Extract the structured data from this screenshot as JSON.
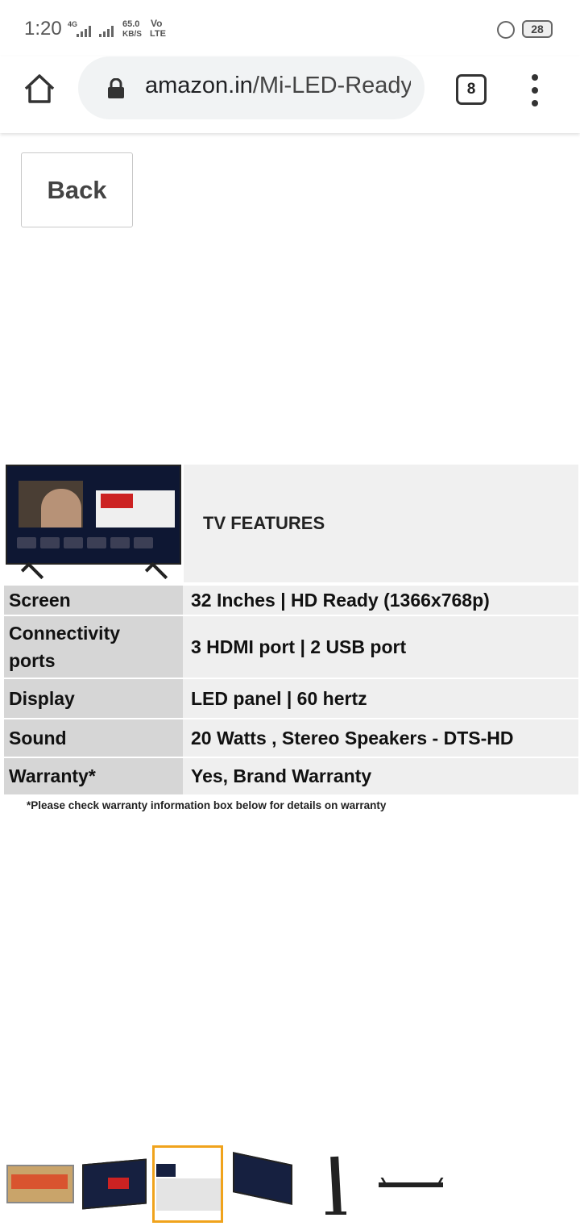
{
  "status_bar": {
    "time": "1:20",
    "net_gen": "4G",
    "speed_value": "65.0",
    "speed_unit": "KB/S",
    "volte_top": "Vo",
    "volte_bottom": "LTE",
    "battery": "28"
  },
  "browser": {
    "url_domain": "amazon.in",
    "url_path": "/Mi-LED-Ready",
    "tab_count": "8"
  },
  "back_button": "Back",
  "product_image": {
    "features_title": "TV FEATURES",
    "specs": [
      {
        "label": "Screen",
        "value": "32 Inches | HD Ready (1366x768p)"
      },
      {
        "label": "Connectivity ports",
        "value": "3 HDMI port | 2 USB port"
      },
      {
        "label": "Display",
        "value": "LED panel | 60 hertz"
      },
      {
        "label": "Sound",
        "value": "20 Watts , Stereo Speakers - DTS-HD"
      },
      {
        "label": "Warranty*",
        "value": "Yes, Brand Warranty"
      }
    ],
    "note": "*Please check warranty information box below for details on warranty"
  },
  "thumbnails": {
    "selected_index": 2,
    "count": 6,
    "selected_color": "#f0a31c"
  }
}
